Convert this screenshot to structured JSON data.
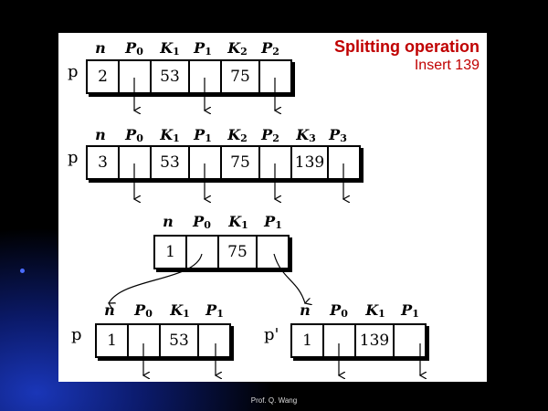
{
  "title": "Splitting operation",
  "subtitle": "Insert 139",
  "footer": "Prof. Q. Wang",
  "header_symbols": {
    "n": "n",
    "P0_base": "P",
    "P0_sub": "0",
    "K1_base": "K",
    "K1_sub": "1",
    "P1_base": "P",
    "P1_sub": "1",
    "K2_base": "K",
    "K2_sub": "2",
    "P2_base": "P",
    "P2_sub": "2",
    "K3_base": "K",
    "K3_sub": "3",
    "P3_base": "P",
    "P3_sub": "3"
  },
  "pointer_labels": {
    "p": "p",
    "p_prime": "p'"
  },
  "node1": {
    "n": "2",
    "k1": "53",
    "k2": "75"
  },
  "node2": {
    "n": "3",
    "k1": "53",
    "k2": "75",
    "k3": "139"
  },
  "node_parent": {
    "n": "1",
    "k1": "75"
  },
  "node_left": {
    "n": "1",
    "k1": "53"
  },
  "node_right": {
    "n": "1",
    "k1": "139"
  },
  "colors": {
    "title": "#c00000",
    "background": "#000000",
    "panel": "#ffffff"
  }
}
